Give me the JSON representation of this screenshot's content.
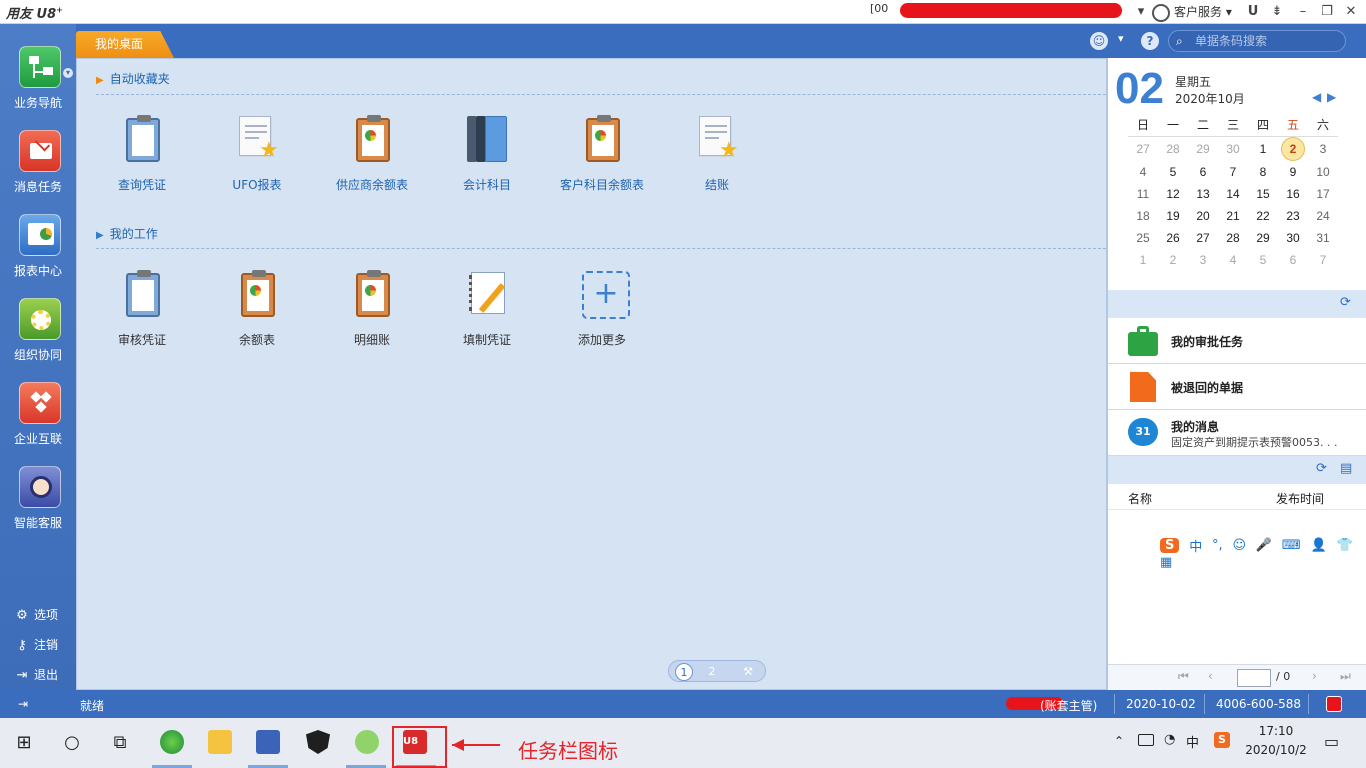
{
  "app": {
    "logo_text": "用友",
    "logo_suffix": "U8",
    "logo_sup": "+",
    "account_prefix": "[00",
    "account_suffix": "]",
    "customer_service": "客户服务",
    "window_icons": [
      "minimize-icon",
      "restore-icon",
      "close-icon"
    ]
  },
  "left_nav": {
    "items": [
      {
        "label": "业务导航",
        "icon": "business-nav-icon",
        "color": "#2fa84f"
      },
      {
        "label": "消息任务",
        "icon": "message-task-icon",
        "color": "#e2483a"
      },
      {
        "label": "报表中心",
        "icon": "report-center-icon",
        "color": "#3a7fd1"
      },
      {
        "label": "组织协同",
        "icon": "org-collab-icon",
        "color": "#6aa83a"
      },
      {
        "label": "企业互联",
        "icon": "enterprise-link-icon",
        "color": "#e2483a"
      },
      {
        "label": "智能客服",
        "icon": "smart-service-icon",
        "color": "#3a5fb5"
      }
    ],
    "bottom": [
      {
        "label": "选项",
        "icon": "gear-icon"
      },
      {
        "label": "注销",
        "icon": "key-icon"
      },
      {
        "label": "退出",
        "icon": "exit-icon"
      }
    ]
  },
  "header": {
    "tab_label": "我的桌面",
    "search_placeholder": "单据条码搜索",
    "help_glyph": "?"
  },
  "desktop": {
    "favorites_title": "自动收藏夹",
    "favorites": [
      "查询凭证",
      "UFO报表",
      "供应商余额表",
      "会计科目",
      "客户科目余额表",
      "结账"
    ],
    "work_title": "我的工作",
    "work": [
      "审核凭证",
      "余额表",
      "明细账",
      "填制凭证",
      "添加更多"
    ],
    "pages": [
      "1",
      "2"
    ]
  },
  "calendar": {
    "day": "02",
    "weekday": "星期五",
    "year_month": "2020年10月",
    "headers": [
      "日",
      "一",
      "二",
      "三",
      "四",
      "五",
      "六"
    ],
    "weeks": [
      [
        "27",
        "28",
        "29",
        "30",
        "1",
        "2",
        "3"
      ],
      [
        "4",
        "5",
        "6",
        "7",
        "8",
        "9",
        "10"
      ],
      [
        "11",
        "12",
        "13",
        "14",
        "15",
        "16",
        "17"
      ],
      [
        "18",
        "19",
        "20",
        "21",
        "22",
        "23",
        "24"
      ],
      [
        "25",
        "26",
        "27",
        "28",
        "29",
        "30",
        "31"
      ],
      [
        "1",
        "2",
        "3",
        "4",
        "5",
        "6",
        "7"
      ]
    ],
    "today": "2"
  },
  "tasks": {
    "approval": "我的审批任务",
    "returned": "被退回的单据",
    "messages_title": "我的消息",
    "messages_badge": "31",
    "messages_preview": "固定资产到期提示表预警0053. . ."
  },
  "msg_table": {
    "col_name": "名称",
    "col_time": "发布时间",
    "page_total": "/ 0"
  },
  "ime_bar": {
    "items": [
      "S",
      "中",
      "°,",
      "☺",
      "🎤",
      "⌨",
      "👤",
      "👕",
      "▦"
    ]
  },
  "status": {
    "ready": "就绪",
    "role": "(账套主管)",
    "date": "2020-10-02",
    "phone": "4006-600-588"
  },
  "taskbar": {
    "time": "17:10",
    "date": "2020/10/2",
    "ime": "中",
    "annotation": "任务栏图标"
  },
  "colors": {
    "primary_blue": "#3a6dbd",
    "tab_orange": "#f29c1f",
    "desktop_bg": "#d6e3f3",
    "annotation_red": "#e3242b"
  }
}
